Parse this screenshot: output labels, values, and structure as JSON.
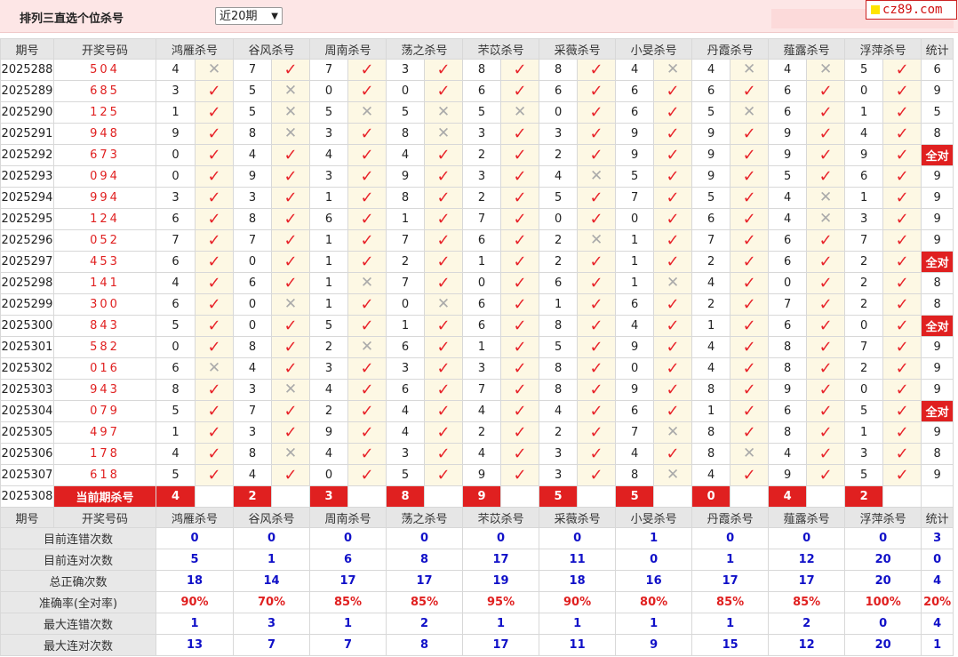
{
  "header": {
    "title": "排列三直选个位杀号",
    "range_selected": "近20期",
    "logo_text": "cz89.com"
  },
  "columns": {
    "period": "期号",
    "draw": "开奖号码",
    "experts": [
      "鸿雁杀号",
      "谷风杀号",
      "周南杀号",
      "荡之杀号",
      "芣苡杀号",
      "采薇杀号",
      "小旻杀号",
      "丹霞杀号",
      "薤露杀号",
      "浮萍杀号"
    ],
    "stat": "统计"
  },
  "marks": {
    "ok": "✓",
    "ng": "✕"
  },
  "rows": [
    {
      "period": "2025288",
      "draw": "504",
      "kills": [
        [
          4,
          0
        ],
        [
          7,
          1
        ],
        [
          7,
          1
        ],
        [
          3,
          1
        ],
        [
          8,
          1
        ],
        [
          8,
          1
        ],
        [
          4,
          0
        ],
        [
          4,
          0
        ],
        [
          4,
          0
        ],
        [
          5,
          1
        ]
      ],
      "stat": "6"
    },
    {
      "period": "2025289",
      "draw": "685",
      "kills": [
        [
          3,
          1
        ],
        [
          5,
          0
        ],
        [
          0,
          1
        ],
        [
          0,
          1
        ],
        [
          6,
          1
        ],
        [
          6,
          1
        ],
        [
          6,
          1
        ],
        [
          6,
          1
        ],
        [
          6,
          1
        ],
        [
          0,
          1
        ]
      ],
      "stat": "9"
    },
    {
      "period": "2025290",
      "draw": "125",
      "kills": [
        [
          1,
          1
        ],
        [
          5,
          0
        ],
        [
          5,
          0
        ],
        [
          5,
          0
        ],
        [
          5,
          0
        ],
        [
          0,
          1
        ],
        [
          6,
          1
        ],
        [
          5,
          0
        ],
        [
          6,
          1
        ],
        [
          1,
          1
        ]
      ],
      "stat": "5"
    },
    {
      "period": "2025291",
      "draw": "948",
      "kills": [
        [
          9,
          1
        ],
        [
          8,
          0
        ],
        [
          3,
          1
        ],
        [
          8,
          0
        ],
        [
          3,
          1
        ],
        [
          3,
          1
        ],
        [
          9,
          1
        ],
        [
          9,
          1
        ],
        [
          9,
          1
        ],
        [
          4,
          1
        ]
      ],
      "stat": "8"
    },
    {
      "period": "2025292",
      "draw": "673",
      "kills": [
        [
          0,
          1
        ],
        [
          4,
          1
        ],
        [
          4,
          1
        ],
        [
          4,
          1
        ],
        [
          2,
          1
        ],
        [
          2,
          1
        ],
        [
          9,
          1
        ],
        [
          9,
          1
        ],
        [
          9,
          1
        ],
        [
          9,
          1
        ]
      ],
      "stat": "全对"
    },
    {
      "period": "2025293",
      "draw": "094",
      "kills": [
        [
          0,
          1
        ],
        [
          9,
          1
        ],
        [
          3,
          1
        ],
        [
          9,
          1
        ],
        [
          3,
          1
        ],
        [
          4,
          0
        ],
        [
          5,
          1
        ],
        [
          9,
          1
        ],
        [
          5,
          1
        ],
        [
          6,
          1
        ]
      ],
      "stat": "9"
    },
    {
      "period": "2025294",
      "draw": "994",
      "kills": [
        [
          3,
          1
        ],
        [
          3,
          1
        ],
        [
          1,
          1
        ],
        [
          8,
          1
        ],
        [
          2,
          1
        ],
        [
          5,
          1
        ],
        [
          7,
          1
        ],
        [
          5,
          1
        ],
        [
          4,
          0
        ],
        [
          1,
          1
        ]
      ],
      "stat": "9"
    },
    {
      "period": "2025295",
      "draw": "124",
      "kills": [
        [
          6,
          1
        ],
        [
          8,
          1
        ],
        [
          6,
          1
        ],
        [
          1,
          1
        ],
        [
          7,
          1
        ],
        [
          0,
          1
        ],
        [
          0,
          1
        ],
        [
          6,
          1
        ],
        [
          4,
          0
        ],
        [
          3,
          1
        ]
      ],
      "stat": "9"
    },
    {
      "period": "2025296",
      "draw": "052",
      "kills": [
        [
          7,
          1
        ],
        [
          7,
          1
        ],
        [
          1,
          1
        ],
        [
          7,
          1
        ],
        [
          6,
          1
        ],
        [
          2,
          0
        ],
        [
          1,
          1
        ],
        [
          7,
          1
        ],
        [
          6,
          1
        ],
        [
          7,
          1
        ]
      ],
      "stat": "9"
    },
    {
      "period": "2025297",
      "draw": "453",
      "kills": [
        [
          6,
          1
        ],
        [
          0,
          1
        ],
        [
          1,
          1
        ],
        [
          2,
          1
        ],
        [
          1,
          1
        ],
        [
          2,
          1
        ],
        [
          1,
          1
        ],
        [
          2,
          1
        ],
        [
          6,
          1
        ],
        [
          2,
          1
        ]
      ],
      "stat": "全对"
    },
    {
      "period": "2025298",
      "draw": "141",
      "kills": [
        [
          4,
          1
        ],
        [
          6,
          1
        ],
        [
          1,
          0
        ],
        [
          7,
          1
        ],
        [
          0,
          1
        ],
        [
          6,
          1
        ],
        [
          1,
          0
        ],
        [
          4,
          1
        ],
        [
          0,
          1
        ],
        [
          2,
          1
        ]
      ],
      "stat": "8"
    },
    {
      "period": "2025299",
      "draw": "300",
      "kills": [
        [
          6,
          1
        ],
        [
          0,
          0
        ],
        [
          1,
          1
        ],
        [
          0,
          0
        ],
        [
          6,
          1
        ],
        [
          1,
          1
        ],
        [
          6,
          1
        ],
        [
          2,
          1
        ],
        [
          7,
          1
        ],
        [
          2,
          1
        ]
      ],
      "stat": "8"
    },
    {
      "period": "2025300",
      "draw": "843",
      "kills": [
        [
          5,
          1
        ],
        [
          0,
          1
        ],
        [
          5,
          1
        ],
        [
          1,
          1
        ],
        [
          6,
          1
        ],
        [
          8,
          1
        ],
        [
          4,
          1
        ],
        [
          1,
          1
        ],
        [
          6,
          1
        ],
        [
          0,
          1
        ]
      ],
      "stat": "全对"
    },
    {
      "period": "2025301",
      "draw": "582",
      "kills": [
        [
          0,
          1
        ],
        [
          8,
          1
        ],
        [
          2,
          0
        ],
        [
          6,
          1
        ],
        [
          1,
          1
        ],
        [
          5,
          1
        ],
        [
          9,
          1
        ],
        [
          4,
          1
        ],
        [
          8,
          1
        ],
        [
          7,
          1
        ]
      ],
      "stat": "9"
    },
    {
      "period": "2025302",
      "draw": "016",
      "kills": [
        [
          6,
          0
        ],
        [
          4,
          1
        ],
        [
          3,
          1
        ],
        [
          3,
          1
        ],
        [
          3,
          1
        ],
        [
          8,
          1
        ],
        [
          0,
          1
        ],
        [
          4,
          1
        ],
        [
          8,
          1
        ],
        [
          2,
          1
        ]
      ],
      "stat": "9"
    },
    {
      "period": "2025303",
      "draw": "943",
      "kills": [
        [
          8,
          1
        ],
        [
          3,
          0
        ],
        [
          4,
          1
        ],
        [
          6,
          1
        ],
        [
          7,
          1
        ],
        [
          8,
          1
        ],
        [
          9,
          1
        ],
        [
          8,
          1
        ],
        [
          9,
          1
        ],
        [
          0,
          1
        ]
      ],
      "stat": "9"
    },
    {
      "period": "2025304",
      "draw": "079",
      "kills": [
        [
          5,
          1
        ],
        [
          7,
          1
        ],
        [
          2,
          1
        ],
        [
          4,
          1
        ],
        [
          4,
          1
        ],
        [
          4,
          1
        ],
        [
          6,
          1
        ],
        [
          1,
          1
        ],
        [
          6,
          1
        ],
        [
          5,
          1
        ]
      ],
      "stat": "全对"
    },
    {
      "period": "2025305",
      "draw": "497",
      "kills": [
        [
          1,
          1
        ],
        [
          3,
          1
        ],
        [
          9,
          1
        ],
        [
          4,
          1
        ],
        [
          2,
          1
        ],
        [
          2,
          1
        ],
        [
          7,
          0
        ],
        [
          8,
          1
        ],
        [
          8,
          1
        ],
        [
          1,
          1
        ]
      ],
      "stat": "9"
    },
    {
      "period": "2025306",
      "draw": "178",
      "kills": [
        [
          4,
          1
        ],
        [
          8,
          0
        ],
        [
          4,
          1
        ],
        [
          3,
          1
        ],
        [
          4,
          1
        ],
        [
          3,
          1
        ],
        [
          4,
          1
        ],
        [
          8,
          0
        ],
        [
          4,
          1
        ],
        [
          3,
          1
        ]
      ],
      "stat": "8"
    },
    {
      "period": "2025307",
      "draw": "618",
      "kills": [
        [
          5,
          1
        ],
        [
          4,
          1
        ],
        [
          0,
          1
        ],
        [
          5,
          1
        ],
        [
          9,
          1
        ],
        [
          3,
          1
        ],
        [
          8,
          0
        ],
        [
          4,
          1
        ],
        [
          9,
          1
        ],
        [
          5,
          1
        ]
      ],
      "stat": "9"
    }
  ],
  "current": {
    "period": "2025308",
    "label": "当前期杀号",
    "kills": [
      "4",
      "2",
      "3",
      "8",
      "9",
      "5",
      "5",
      "0",
      "4",
      "2"
    ]
  },
  "summary": [
    {
      "label": "目前连错次数",
      "values": [
        "0",
        "0",
        "0",
        "0",
        "0",
        "0",
        "1",
        "0",
        "0",
        "0"
      ],
      "stat": "3",
      "red": false
    },
    {
      "label": "目前连对次数",
      "values": [
        "5",
        "1",
        "6",
        "8",
        "17",
        "11",
        "0",
        "1",
        "12",
        "20"
      ],
      "stat": "0",
      "red": false
    },
    {
      "label": "总正确次数",
      "values": [
        "18",
        "14",
        "17",
        "17",
        "19",
        "18",
        "16",
        "17",
        "17",
        "20"
      ],
      "stat": "4",
      "red": false
    },
    {
      "label": "准确率(全对率)",
      "values": [
        "90%",
        "70%",
        "85%",
        "85%",
        "95%",
        "90%",
        "80%",
        "85%",
        "85%",
        "100%"
      ],
      "stat": "20%",
      "red": true
    },
    {
      "label": "最大连错次数",
      "values": [
        "1",
        "3",
        "1",
        "2",
        "1",
        "1",
        "1",
        "1",
        "2",
        "0"
      ],
      "stat": "4",
      "red": false
    },
    {
      "label": "最大连对次数",
      "values": [
        "13",
        "7",
        "7",
        "8",
        "17",
        "11",
        "9",
        "15",
        "12",
        "20"
      ],
      "stat": "1",
      "red": false
    }
  ]
}
